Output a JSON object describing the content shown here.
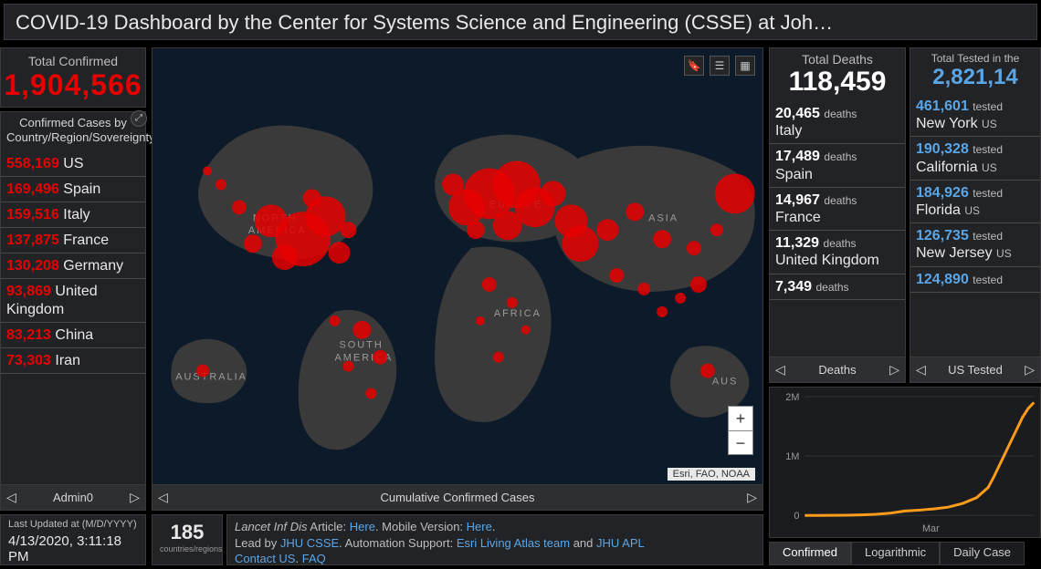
{
  "title": "COVID-19 Dashboard by the Center for Systems Science and Engineering (CSSE) at Joh…",
  "confirmed": {
    "label": "Total Confirmed",
    "value": "1,904,566"
  },
  "cases_panel": {
    "heading": "Confirmed Cases by Country/Region/Sovereignty",
    "rows": [
      {
        "num": "558,169",
        "loc": "US"
      },
      {
        "num": "169,496",
        "loc": "Spain"
      },
      {
        "num": "159,516",
        "loc": "Italy"
      },
      {
        "num": "137,875",
        "loc": "France"
      },
      {
        "num": "130,208",
        "loc": "Germany"
      },
      {
        "num": "93,869",
        "loc": "United Kingdom"
      },
      {
        "num": "83,213",
        "loc": "China"
      },
      {
        "num": "73,303",
        "loc": "Iran"
      }
    ],
    "nav": "Admin0"
  },
  "map": {
    "nav": "Cumulative Confirmed Cases",
    "attribution": "Esri, FAO, NOAA",
    "labels": [
      "NORTH AMERICA",
      "SOUTH AMERICA",
      "EUROPE",
      "AFRICA",
      "ASIA",
      "AUSTRALIA",
      "AUS"
    ]
  },
  "deaths": {
    "label": "Total Deaths",
    "value": "118,459",
    "rows": [
      {
        "num": "20,465",
        "suffix": "deaths",
        "loc": "Italy"
      },
      {
        "num": "17,489",
        "suffix": "deaths",
        "loc": "Spain"
      },
      {
        "num": "14,967",
        "suffix": "deaths",
        "loc": "France"
      },
      {
        "num": "11,329",
        "suffix": "deaths",
        "loc": "United Kingdom"
      },
      {
        "num": "7,349",
        "suffix": "deaths",
        "loc": ""
      }
    ],
    "nav": "Deaths"
  },
  "tested": {
    "label": "Total Tested in the",
    "value": "2,821,14",
    "rows": [
      {
        "num": "461,601",
        "suffix": "tested",
        "loc": "New York",
        "sub": "US"
      },
      {
        "num": "190,328",
        "suffix": "tested",
        "loc": "California",
        "sub": "US"
      },
      {
        "num": "184,926",
        "suffix": "tested",
        "loc": "Florida",
        "sub": "US"
      },
      {
        "num": "126,735",
        "suffix": "tested",
        "loc": "New Jersey",
        "sub": "US"
      },
      {
        "num": "124,890",
        "suffix": "tested",
        "loc": "",
        "sub": ""
      }
    ],
    "nav": "US Tested"
  },
  "footer": {
    "updated_label": "Last Updated at (M/D/YYYY)",
    "updated_value": "4/13/2020, 3:11:18 PM",
    "countries_value": "185",
    "countries_label": "countries/regions",
    "credits_line1_a": "Lancet Inf Dis",
    "credits_line1_b": " Article: ",
    "here1": "Here",
    "credits_line1_c": ". Mobile Version: ",
    "here2": "Here",
    "credits_line2_a": "Lead by ",
    "jhu_csse": "JHU CSSE",
    "credits_line2_b": ". Automation Support: ",
    "esri_team": "Esri Living Atlas team",
    "and": " and ",
    "jhu_apl": "JHU APL",
    "credits_line3": "Contact US",
    "faq": "FAQ"
  },
  "chart_tabs": [
    "Confirmed",
    "Logarithmic",
    "Daily Case"
  ],
  "chart_data": {
    "type": "line",
    "title": "",
    "xlabel": "",
    "ylabel": "",
    "ylim": [
      0,
      2000000
    ],
    "y_ticks": [
      "0",
      "1M",
      "2M"
    ],
    "x_ticks": [
      "Mar"
    ],
    "series": [
      {
        "name": "Confirmed",
        "color": "#ff9c1a",
        "x": [
          0,
          5,
          10,
          15,
          20,
          25,
          30,
          35,
          40,
          45,
          50,
          55,
          60,
          64,
          66,
          68,
          70,
          72,
          74,
          76,
          78,
          80
        ],
        "y": [
          500,
          1000,
          2000,
          5000,
          10000,
          20000,
          40000,
          75000,
          90000,
          110000,
          140000,
          200000,
          300000,
          470000,
          650000,
          850000,
          1050000,
          1250000,
          1450000,
          1650000,
          1800000,
          1900000
        ]
      }
    ]
  }
}
